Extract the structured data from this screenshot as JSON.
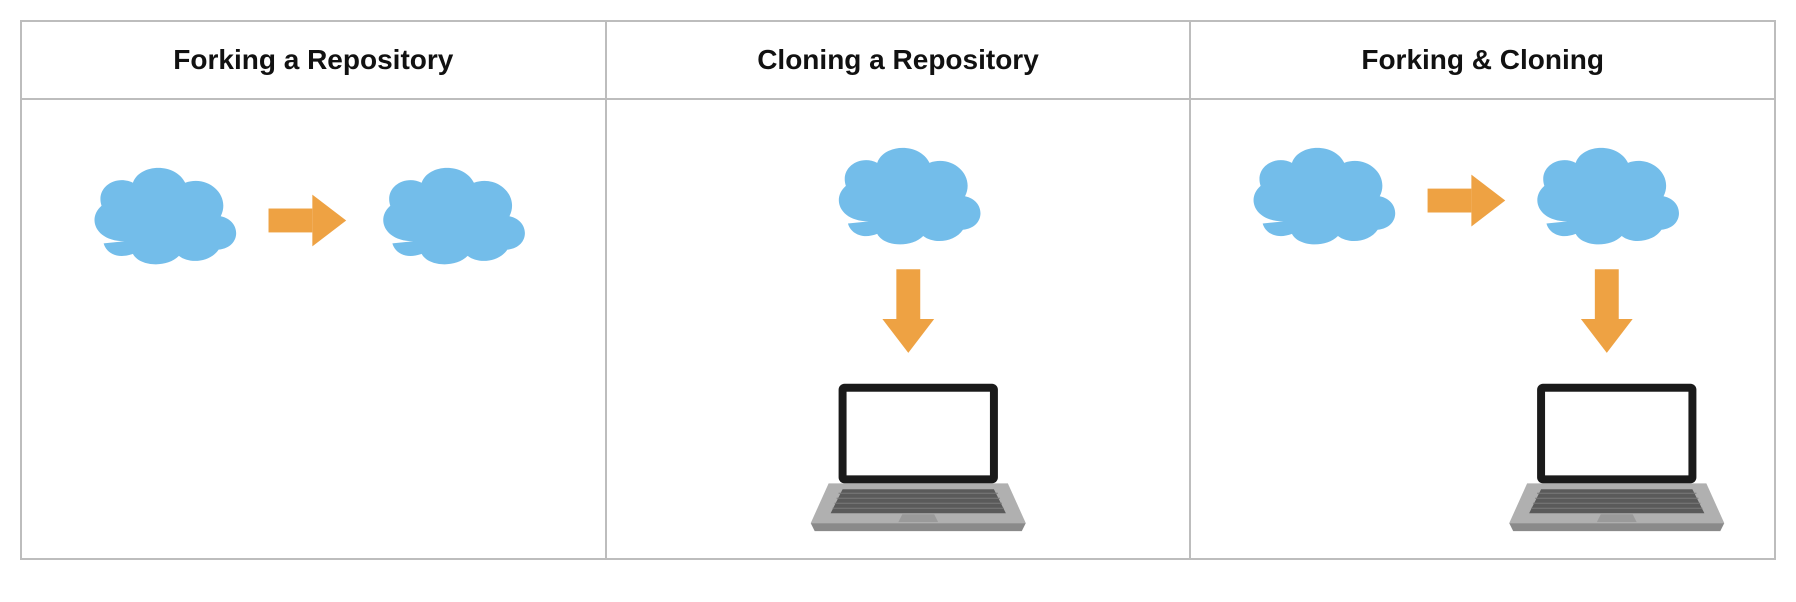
{
  "columns": [
    {
      "title": "Forking a Repository"
    },
    {
      "title": "Cloning a Repository"
    },
    {
      "title": "Forking & Cloning"
    }
  ],
  "icons": {
    "cloud_label": "cloud",
    "arrow_right_label": "arrow-right",
    "arrow_down_label": "arrow-down",
    "laptop_label": "laptop"
  },
  "colors": {
    "cloud": "#73bdea",
    "arrow": "#eea243",
    "laptop_body": "#8e8e8e",
    "laptop_screen_border": "#1a1a1a",
    "border": "#bdbdbd"
  }
}
